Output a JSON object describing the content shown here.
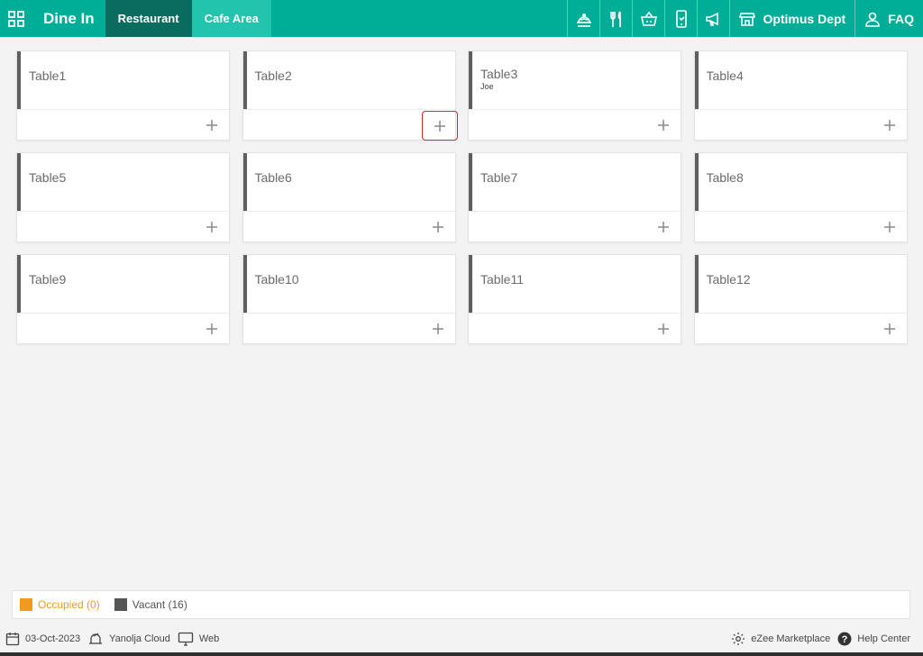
{
  "header": {
    "title": "Dine In",
    "tabs": [
      {
        "label": "Restaurant",
        "active": true
      },
      {
        "label": "Cafe Area",
        "active": false
      }
    ],
    "dept_label": "Optimus Dept",
    "faq_label": "FAQ",
    "icons": [
      "dish-icon",
      "fork-knife-icon",
      "basket-icon",
      "mobile-order-icon",
      "megaphone-icon"
    ]
  },
  "tables": [
    {
      "name": "Table1",
      "guest": ""
    },
    {
      "name": "Table2",
      "guest": ""
    },
    {
      "name": "Table3",
      "guest": "Joe"
    },
    {
      "name": "Table4",
      "guest": ""
    },
    {
      "name": "Table5",
      "guest": ""
    },
    {
      "name": "Table6",
      "guest": ""
    },
    {
      "name": "Table7",
      "guest": ""
    },
    {
      "name": "Table8",
      "guest": ""
    },
    {
      "name": "Table9",
      "guest": ""
    },
    {
      "name": "Table10",
      "guest": ""
    },
    {
      "name": "Table11",
      "guest": ""
    },
    {
      "name": "Table12",
      "guest": ""
    }
  ],
  "legend": {
    "occupied": "Occupied (0)",
    "vacant": "Vacant (16)",
    "occupied_color": "#f39a1e",
    "vacant_color": "#555555"
  },
  "statusbar": {
    "date": "03-Oct-2023",
    "cloud": "Yanolja Cloud",
    "platform": "Web",
    "marketplace": "eZee Marketplace",
    "help": "Help Center"
  },
  "colors": {
    "accent": "#00ad96",
    "active_tab": "#0a6b5f",
    "inactive_tab": "#23c4ae",
    "highlight": "#e0262a"
  }
}
